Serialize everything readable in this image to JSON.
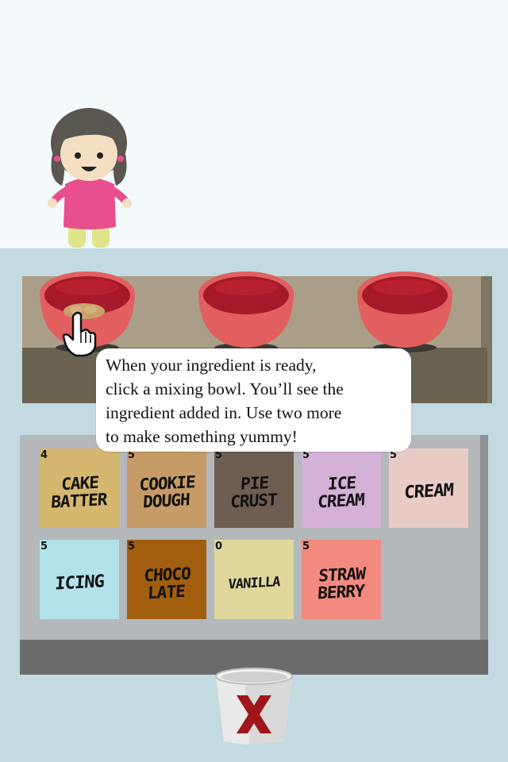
{
  "tooltip": {
    "lines": [
      "When your ingredient is ready,",
      "click a mixing bowl. You’ll see the",
      "ingredient added in. Use two more",
      "to make something yummy!"
    ]
  },
  "bowls": [
    {
      "name": "mixing-bowl-1",
      "has_ingredient": true
    },
    {
      "name": "mixing-bowl-2",
      "has_ingredient": false
    },
    {
      "name": "mixing-bowl-3",
      "has_ingredient": false
    }
  ],
  "ingredients": [
    {
      "label_lines": [
        "CAKE",
        "BATTER"
      ],
      "count": "4",
      "color": "#d6b76f"
    },
    {
      "label_lines": [
        "COOKIE",
        "DOUGH"
      ],
      "count": "5",
      "color": "#c79b67"
    },
    {
      "label_lines": [
        "PIE",
        "CRUST"
      ],
      "count": "5",
      "color": "#6e5e52"
    },
    {
      "label_lines": [
        "ICE",
        "CREAM"
      ],
      "count": "5",
      "color": "#d4b1d6"
    },
    {
      "label_lines": [
        "CREAM"
      ],
      "count": "5",
      "color": "#e9cbc6"
    },
    {
      "label_lines": [
        "ICING"
      ],
      "count": "5",
      "color": "#b3e3ea"
    },
    {
      "label_lines": [
        "CHOCO",
        "LATE"
      ],
      "count": "5",
      "color": "#a15e0e"
    },
    {
      "label_lines": [
        "VANILLA"
      ],
      "count": "0",
      "color": "#e0d79c"
    },
    {
      "label_lines": [
        "STRAW",
        "BERRY"
      ],
      "count": "5",
      "color": "#f38a7f"
    }
  ],
  "trash": {
    "icon": "x-mark-icon",
    "color": "#a0141c"
  },
  "colors": {
    "bowl_outer": "#e25f5f",
    "bowl_inner": "#a6192a",
    "shelf": "#ab9e89"
  }
}
